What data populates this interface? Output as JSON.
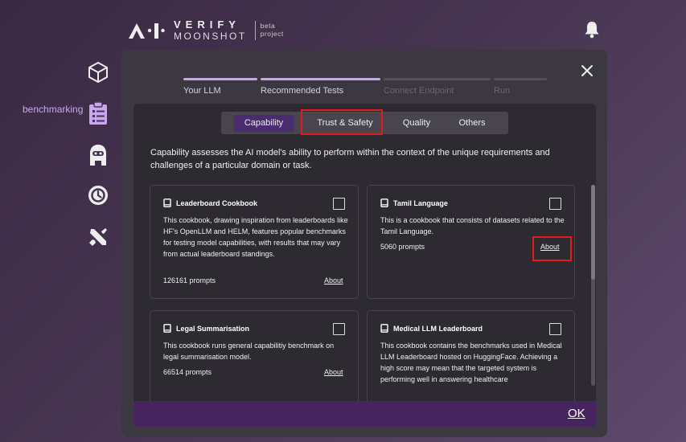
{
  "header": {
    "logo_verify": "VERIFY",
    "logo_moonshot": "MOONSHOT",
    "logo_beta_line1": "beta",
    "logo_beta_line2": "project",
    "bell_icon": "bell-icon"
  },
  "nav": {
    "items": [
      {
        "icon": "cube-icon"
      },
      {
        "icon": "clipboard-icon",
        "label": "benchmarking",
        "active": true
      },
      {
        "icon": "robot-icon"
      },
      {
        "icon": "history-icon"
      },
      {
        "icon": "tools-icon"
      }
    ]
  },
  "modal": {
    "steps": [
      {
        "label": "Your LLM",
        "state": "done"
      },
      {
        "label": "Recommended Tests",
        "state": "active"
      },
      {
        "label": "Connect Endpoint",
        "state": "pending"
      },
      {
        "label": "Run",
        "state": "pending"
      }
    ],
    "tabs": [
      {
        "label": "Capability",
        "active": true
      },
      {
        "label": "Trust & Safety",
        "active": false
      },
      {
        "label": "Quality",
        "active": false
      },
      {
        "label": "Others",
        "active": false
      }
    ],
    "description": "Capability assesses the AI model's ability to perform within the context of the unique requirements and challenges of a particular domain or task.",
    "cards": [
      {
        "title": "Leaderboard Cookbook",
        "text": "This cookbook, drawing inspiration from leaderboards like HF's OpenLLM and HELM, features popular benchmarks for testing model capabilities, with results that may vary from actual leaderboard standings.",
        "count": "126161 prompts",
        "about": "About"
      },
      {
        "title": "Tamil Language",
        "text": "This is a cookbook that consists of datasets related to the Tamil Language.",
        "count": "5060 prompts",
        "about": "About"
      },
      {
        "title": "Legal Summarisation",
        "text": "This cookbook runs general capabilitiy benchmark on legal summarisation model.",
        "count": "66514 prompts",
        "about": "About"
      },
      {
        "title": "Medical LLM Leaderboard",
        "text": "This cookbook contains the benchmarks used in Medical LLM Leaderboard hosted on HuggingFace. Achieving a high score may mean that the targeted system is performing well in answering healthcare",
        "count": "",
        "about": ""
      }
    ],
    "ok_label": "OK"
  },
  "colors": {
    "accent": "#c9a6ef",
    "active_tab": "#4a2c71",
    "footer": "#46255e",
    "highlight": "#e21c1c"
  }
}
